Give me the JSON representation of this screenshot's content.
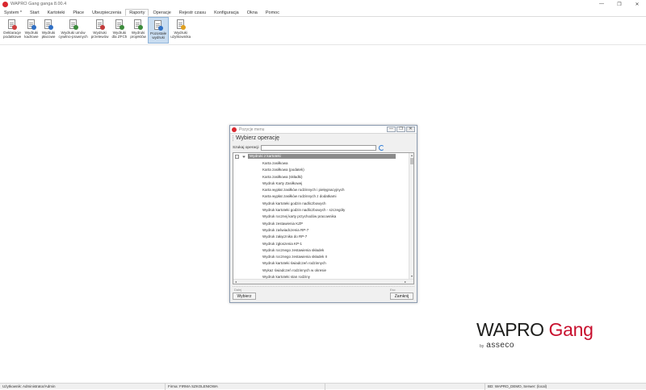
{
  "app": {
    "title": "WAPRO Gang ganga 8.00.4",
    "window_controls": {
      "minimize": "—",
      "restore": "❐",
      "close": "✕"
    }
  },
  "menubar": {
    "items": [
      {
        "label": "System *"
      },
      {
        "label": "Start"
      },
      {
        "label": "Kartoteki"
      },
      {
        "label": "Płace"
      },
      {
        "label": "Ubezpieczenia"
      },
      {
        "label": "Raporty"
      },
      {
        "label": "Operacje"
      },
      {
        "label": "Rejestr czasu"
      },
      {
        "label": "Konfiguracja"
      },
      {
        "label": "Okna"
      },
      {
        "label": "Pomoc"
      }
    ],
    "active_index": 5
  },
  "ribbon": {
    "buttons": [
      {
        "line1": "Deklaracje",
        "line2": "podatkowe",
        "icon": "tax-declaration-icon",
        "badge_color": "#d04040"
      },
      {
        "line1": "Wydruki",
        "line2": "kadrowe",
        "icon": "hr-printout-icon",
        "badge_color": "#2f6fc4"
      },
      {
        "line1": "Wydruki",
        "line2": "płacowe",
        "icon": "payroll-printout-icon",
        "badge_color": "#2f6fc4"
      },
      {
        "line1": "Wydruki umów",
        "line2": "cywilno-prawnych",
        "icon": "civil-contract-printout-icon",
        "badge_color": "#3b8b3b"
      },
      {
        "line1": "Wydruki",
        "line2": "przelewów",
        "icon": "transfer-printout-icon",
        "badge_color": "#c23b3b"
      },
      {
        "line1": "Wydruki",
        "line2": "dla ZFCh",
        "icon": "zfch-printout-icon",
        "badge_color": "#3b8b3b"
      },
      {
        "line1": "Wydruki",
        "line2": "projektów",
        "icon": "project-printout-icon",
        "badge_color": "#3b8b3b"
      },
      {
        "line1": "Pozostałe",
        "line2": "wydruki",
        "icon": "other-printouts-icon",
        "badge_color": "#2f6fc4"
      },
      {
        "line1": "Wydruki",
        "line2": "użytkownika",
        "icon": "user-printouts-icon",
        "badge_color": "#e0a020"
      }
    ],
    "selected_index": 7
  },
  "dialog": {
    "title": "Pozycje menu",
    "header": "Wybierz operację",
    "search_label": "Szukaj operacji",
    "search_value": "",
    "root_label": "Wydruki z kartoteki",
    "expander": "−",
    "items": [
      "Karta zasiłkowa",
      "Karta zasiłkowa (podatek)",
      "Karta zasiłkowa (składki)",
      "Wydruk Karty Zasiłkowej",
      "Karta wypłat zasiłków rodzinnych i pielęgnacyjnych",
      "Karta wypłat zasiłków rodzinnych z dodatkami",
      "Wydruk kartoteki godzin nadliczbowych",
      "Wydruk kartoteki godzin nadliczbowych - szczegóły",
      "Wydruk rocznej karty przychodów pracownika",
      "Wydruk zestawienia KZP",
      "Wydruk zaświadczenia RP-7",
      "Wydruk załącznika do RP-7",
      "Wydruk zgłoszenia KP-1",
      "Wydruk rocznego zestawienia składek",
      "Wydruk rocznego zestawienia składek II",
      "Wydruk kartoteki świadczeń rodzinnych",
      "Wykaz świadczeń rodzinnych w okresie",
      "Wydruk kartoteki stan rodziny"
    ],
    "caption_left": "Dalej",
    "caption_right": "Esc",
    "choose_button": "Wybierz",
    "close_button": "Zamknij"
  },
  "brand": {
    "wapro": "WAPRO",
    "gang": "Gang",
    "by": "by",
    "asseco": "asseco"
  },
  "statusbar": {
    "user": "Użytkownik: Administrator/Admin",
    "company": "Firma: FIRMA SZKOLENIOWA",
    "database": "BD: WAPRO_DEMO, Serwer: (local)"
  }
}
